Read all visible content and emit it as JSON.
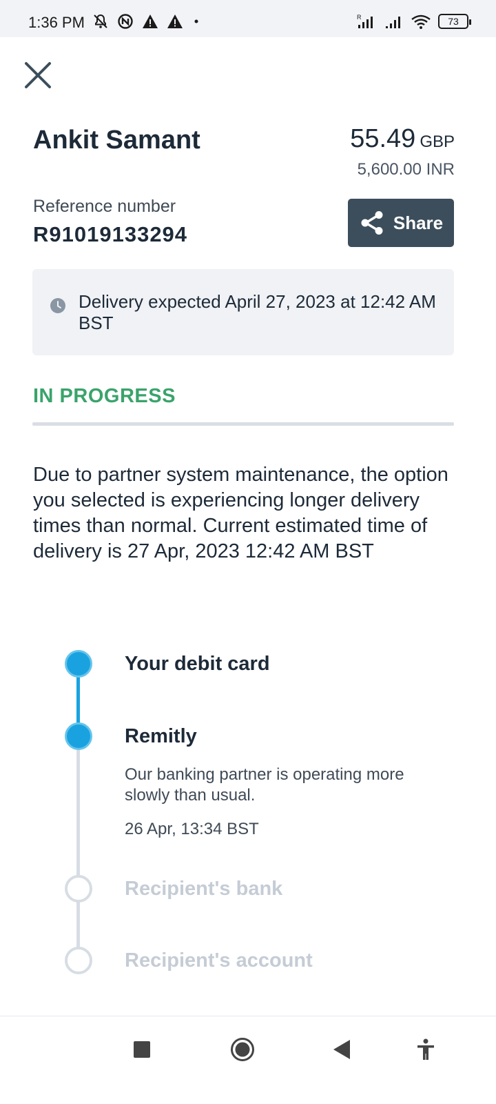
{
  "status_bar": {
    "time": "1:36 PM",
    "battery": "73",
    "icons_left": [
      "notifications-off-icon",
      "app-icon",
      "warning-icon",
      "warning-icon",
      "dot-icon"
    ],
    "icons_right": [
      "signal-roaming-icon",
      "signal-icon",
      "wifi-icon",
      "battery-icon"
    ]
  },
  "header": {
    "close_icon": "close-icon"
  },
  "transfer": {
    "recipient_name": "Ankit Samant",
    "amount": "55.49",
    "amount_currency": "GBP",
    "received_amount": "5,600.00 INR",
    "reference_label": "Reference number",
    "reference_number": "R91019133294",
    "share_label": "Share",
    "delivery_text": "Delivery expected April 27, 2023 at 12:42 AM BST",
    "status": "IN PROGRESS",
    "notice": "Due to partner system maintenance, the option you selected is experiencing longer delivery times than normal. Current estimated time of delivery is 27 Apr, 2023 12:42 AM BST"
  },
  "timeline": {
    "steps": [
      {
        "title": "Your debit card",
        "state": "done"
      },
      {
        "title": "Remitly",
        "state": "current",
        "description": "Our banking partner is operating more slowly than usual.",
        "time": "26 Apr, 13:34 BST"
      },
      {
        "title": "Recipient's bank",
        "state": "pending"
      },
      {
        "title": "Recipient's account",
        "state": "pending"
      }
    ]
  },
  "nav": {
    "buttons": [
      "recent-apps-icon",
      "home-icon",
      "back-icon",
      "accessibility-icon"
    ]
  },
  "colors": {
    "accent_blue": "#1aa2e0",
    "status_green": "#3aa36b",
    "share_button": "#3c4e5c",
    "text_dark": "#1d2a38"
  }
}
